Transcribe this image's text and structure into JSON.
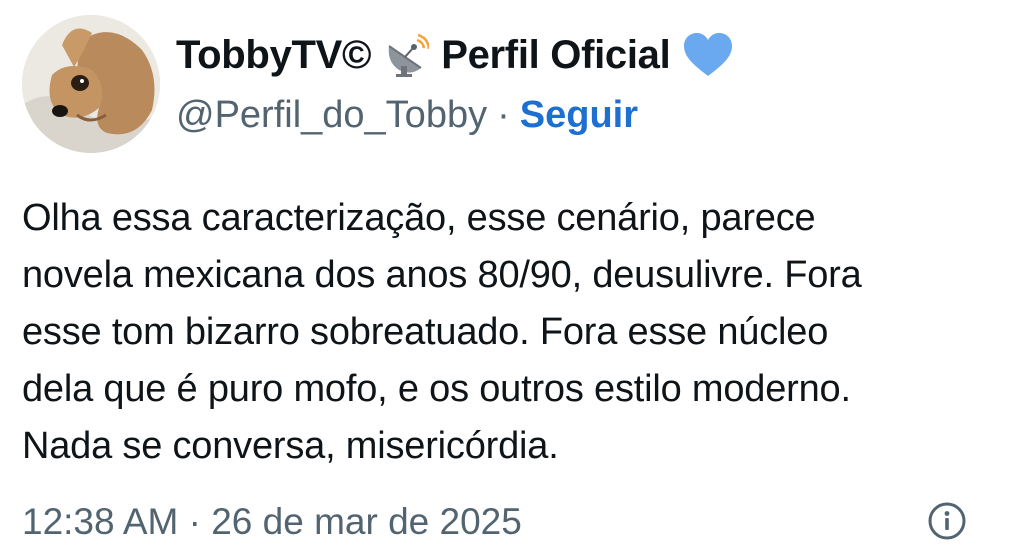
{
  "author": {
    "display_name": "TobbyTV©",
    "official_label": "Perfil Oficial",
    "handle": "@Perfil_do_Tobby",
    "separator": "·",
    "follow_label": "Seguir",
    "avatar_icon": "dog-avatar",
    "badge_icons": [
      "satellite-antenna-icon",
      "blue-heart-icon"
    ]
  },
  "tweet": {
    "lines": [
      "Olha essa caracterização, esse cenário, parece",
      "novela mexicana dos anos 80/90, deusulivre. Fora",
      "esse tom bizarro sobreatuado. Fora esse núcleo",
      "dela que é puro mofo, e os outros estilo moderno.",
      "Nada se conversa, misericórdia."
    ]
  },
  "meta": {
    "timestamp": "12:38 AM · 26 de mar de 2025",
    "info_icon": "info-icon"
  },
  "colors": {
    "text": "#0f1419",
    "secondary": "#536471",
    "link": "#1d6fd1",
    "heart": "#6aa8f0"
  }
}
